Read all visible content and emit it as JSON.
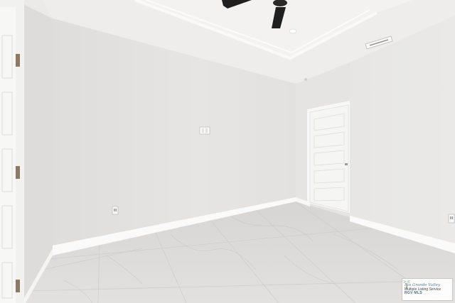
{
  "scene": {
    "subject": "empty-room-interior",
    "watermark": {
      "line1": "Rio Grande Valley",
      "line2": "Multiple Listing Service",
      "line3": "RGV MLS",
      "icon": "palm-tree-icon"
    }
  },
  "colors": {
    "wall": "#e4e3e1",
    "wall_shadow": "#dcdbd9",
    "ceiling": "#efeeec",
    "marble": "#dedcda",
    "baseboard": "#fafafa",
    "door": "#f6f6f6",
    "fan_blade": "#1e1e1e"
  }
}
